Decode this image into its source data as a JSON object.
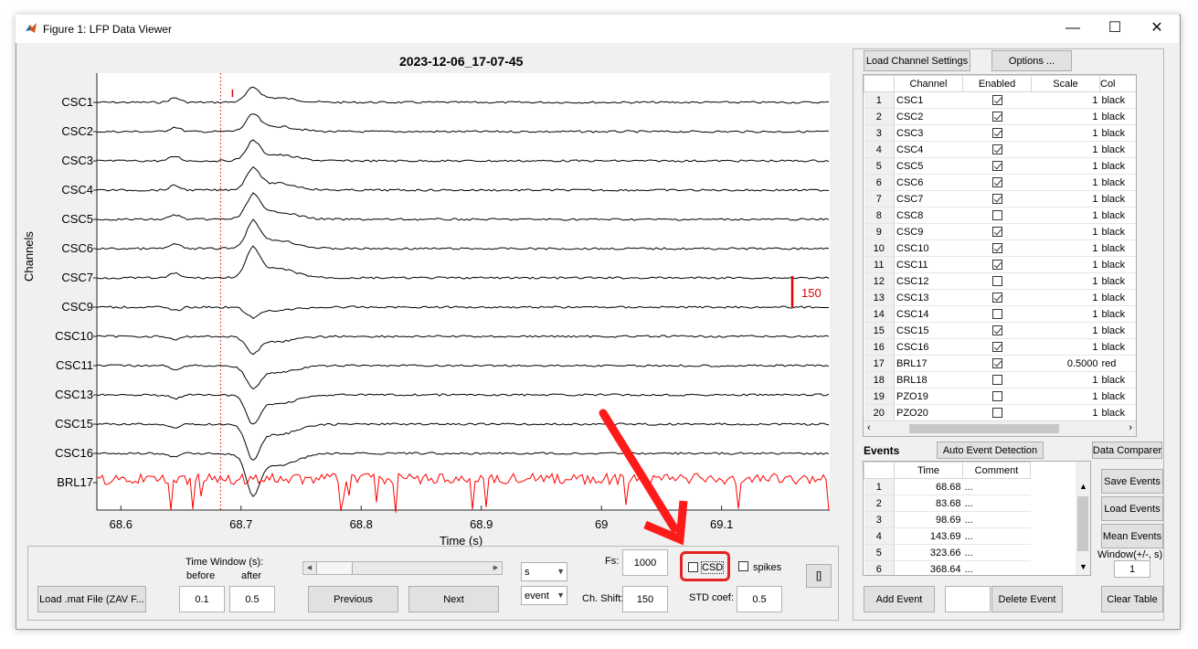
{
  "window": {
    "title": "Figure 1: LFP Data Viewer",
    "controls": [
      "minimize-icon",
      "maximize-icon",
      "close-icon"
    ]
  },
  "plot": {
    "title": "2023-12-06_17-07-45",
    "ylabel": "Channels",
    "xlabel": "Time (s)",
    "channels": [
      "CSC1",
      "CSC2",
      "CSC3",
      "CSC4",
      "CSC5",
      "CSC6",
      "CSC7",
      "CSC9",
      "CSC10",
      "CSC11",
      "CSC13",
      "CSC15",
      "CSC16",
      "BRL17"
    ],
    "xticks": [
      "68.6",
      "68.7",
      "68.8",
      "68.9",
      "69",
      "69.1"
    ],
    "scale_bar_label": "150",
    "trace_color": "#000000",
    "highlight_color": "#ff0000"
  },
  "chart_data": {
    "type": "line",
    "title": "2023-12-06_17-07-45",
    "xlabel": "Time (s)",
    "ylabel": "Channels",
    "xlim": [
      68.58,
      69.19
    ],
    "event_marker_x": 68.683,
    "scale_bar_uV": 150,
    "series": [
      {
        "name": "CSC1",
        "color": "#000000"
      },
      {
        "name": "CSC2",
        "color": "#000000"
      },
      {
        "name": "CSC3",
        "color": "#000000"
      },
      {
        "name": "CSC4",
        "color": "#000000"
      },
      {
        "name": "CSC5",
        "color": "#000000"
      },
      {
        "name": "CSC6",
        "color": "#000000"
      },
      {
        "name": "CSC7",
        "color": "#000000"
      },
      {
        "name": "CSC9",
        "color": "#000000"
      },
      {
        "name": "CSC10",
        "color": "#000000"
      },
      {
        "name": "CSC11",
        "color": "#000000"
      },
      {
        "name": "CSC13",
        "color": "#000000"
      },
      {
        "name": "CSC15",
        "color": "#000000"
      },
      {
        "name": "CSC16",
        "color": "#000000"
      },
      {
        "name": "BRL17",
        "color": "#ff0000"
      }
    ]
  },
  "controls": {
    "load_mat_label": "Load .mat File (ZAV F...",
    "time_window_label": "Time Window (s):",
    "before_label": "before",
    "after_label": "after",
    "before_value": "0.1",
    "after_value": "0.5",
    "previous_label": "Previous",
    "next_label": "Next",
    "unit_select": "s",
    "nav_select": "event",
    "fs_label": "Fs:",
    "fs_value": "1000",
    "ch_shift_label": "Ch. Shift:",
    "ch_shift_value": "150",
    "csd_label": "CSD",
    "spikes_label": "spikes",
    "std_coef_label": "STD coef:",
    "std_coef_value": "0.5",
    "bracket_label": "[]"
  },
  "channel_panel": {
    "load_settings_label": "Load Channel Settings",
    "options_label": "Options ...",
    "columns": [
      "Channel",
      "Enabled",
      "Scale",
      "Col"
    ],
    "rows": [
      {
        "n": "1",
        "name": "CSC1",
        "enabled": true,
        "scale": "1",
        "color": "black"
      },
      {
        "n": "2",
        "name": "CSC2",
        "enabled": true,
        "scale": "1",
        "color": "black"
      },
      {
        "n": "3",
        "name": "CSC3",
        "enabled": true,
        "scale": "1",
        "color": "black"
      },
      {
        "n": "4",
        "name": "CSC4",
        "enabled": true,
        "scale": "1",
        "color": "black"
      },
      {
        "n": "5",
        "name": "CSC5",
        "enabled": true,
        "scale": "1",
        "color": "black"
      },
      {
        "n": "6",
        "name": "CSC6",
        "enabled": true,
        "scale": "1",
        "color": "black"
      },
      {
        "n": "7",
        "name": "CSC7",
        "enabled": true,
        "scale": "1",
        "color": "black"
      },
      {
        "n": "8",
        "name": "CSC8",
        "enabled": false,
        "scale": "1",
        "color": "black"
      },
      {
        "n": "9",
        "name": "CSC9",
        "enabled": true,
        "scale": "1",
        "color": "black"
      },
      {
        "n": "10",
        "name": "CSC10",
        "enabled": true,
        "scale": "1",
        "color": "black"
      },
      {
        "n": "11",
        "name": "CSC11",
        "enabled": true,
        "scale": "1",
        "color": "black"
      },
      {
        "n": "12",
        "name": "CSC12",
        "enabled": false,
        "scale": "1",
        "color": "black"
      },
      {
        "n": "13",
        "name": "CSC13",
        "enabled": true,
        "scale": "1",
        "color": "black"
      },
      {
        "n": "14",
        "name": "CSC14",
        "enabled": false,
        "scale": "1",
        "color": "black"
      },
      {
        "n": "15",
        "name": "CSC15",
        "enabled": true,
        "scale": "1",
        "color": "black"
      },
      {
        "n": "16",
        "name": "CSC16",
        "enabled": true,
        "scale": "1",
        "color": "black"
      },
      {
        "n": "17",
        "name": "BRL17",
        "enabled": true,
        "scale": "0.5000",
        "color": "red"
      },
      {
        "n": "18",
        "name": "BRL18",
        "enabled": false,
        "scale": "1",
        "color": "black"
      },
      {
        "n": "19",
        "name": "PZO19",
        "enabled": false,
        "scale": "1",
        "color": "black"
      },
      {
        "n": "20",
        "name": "PZO20",
        "enabled": false,
        "scale": "1",
        "color": "black"
      }
    ]
  },
  "events_panel": {
    "title": "Events",
    "auto_detect_label": "Auto Event Detection",
    "data_comparer_label": "Data Comparer",
    "columns": [
      "Time",
      "Comment"
    ],
    "rows": [
      {
        "n": "1",
        "time": "68.68",
        "comment": "..."
      },
      {
        "n": "2",
        "time": "83.68",
        "comment": "..."
      },
      {
        "n": "3",
        "time": "98.69",
        "comment": "..."
      },
      {
        "n": "4",
        "time": "143.69",
        "comment": "..."
      },
      {
        "n": "5",
        "time": "323.66",
        "comment": "..."
      },
      {
        "n": "6",
        "time": "368.64",
        "comment": "..."
      }
    ],
    "save_events_label": "Save Events",
    "load_events_label": "Load Events",
    "mean_events_label": "Mean Events",
    "window_label": "Window(+/-, s)",
    "window_value": "1",
    "add_event_label": "Add Event",
    "delete_event_label": "Delete Event",
    "clear_table_label": "Clear Table",
    "event_input_value": ""
  }
}
